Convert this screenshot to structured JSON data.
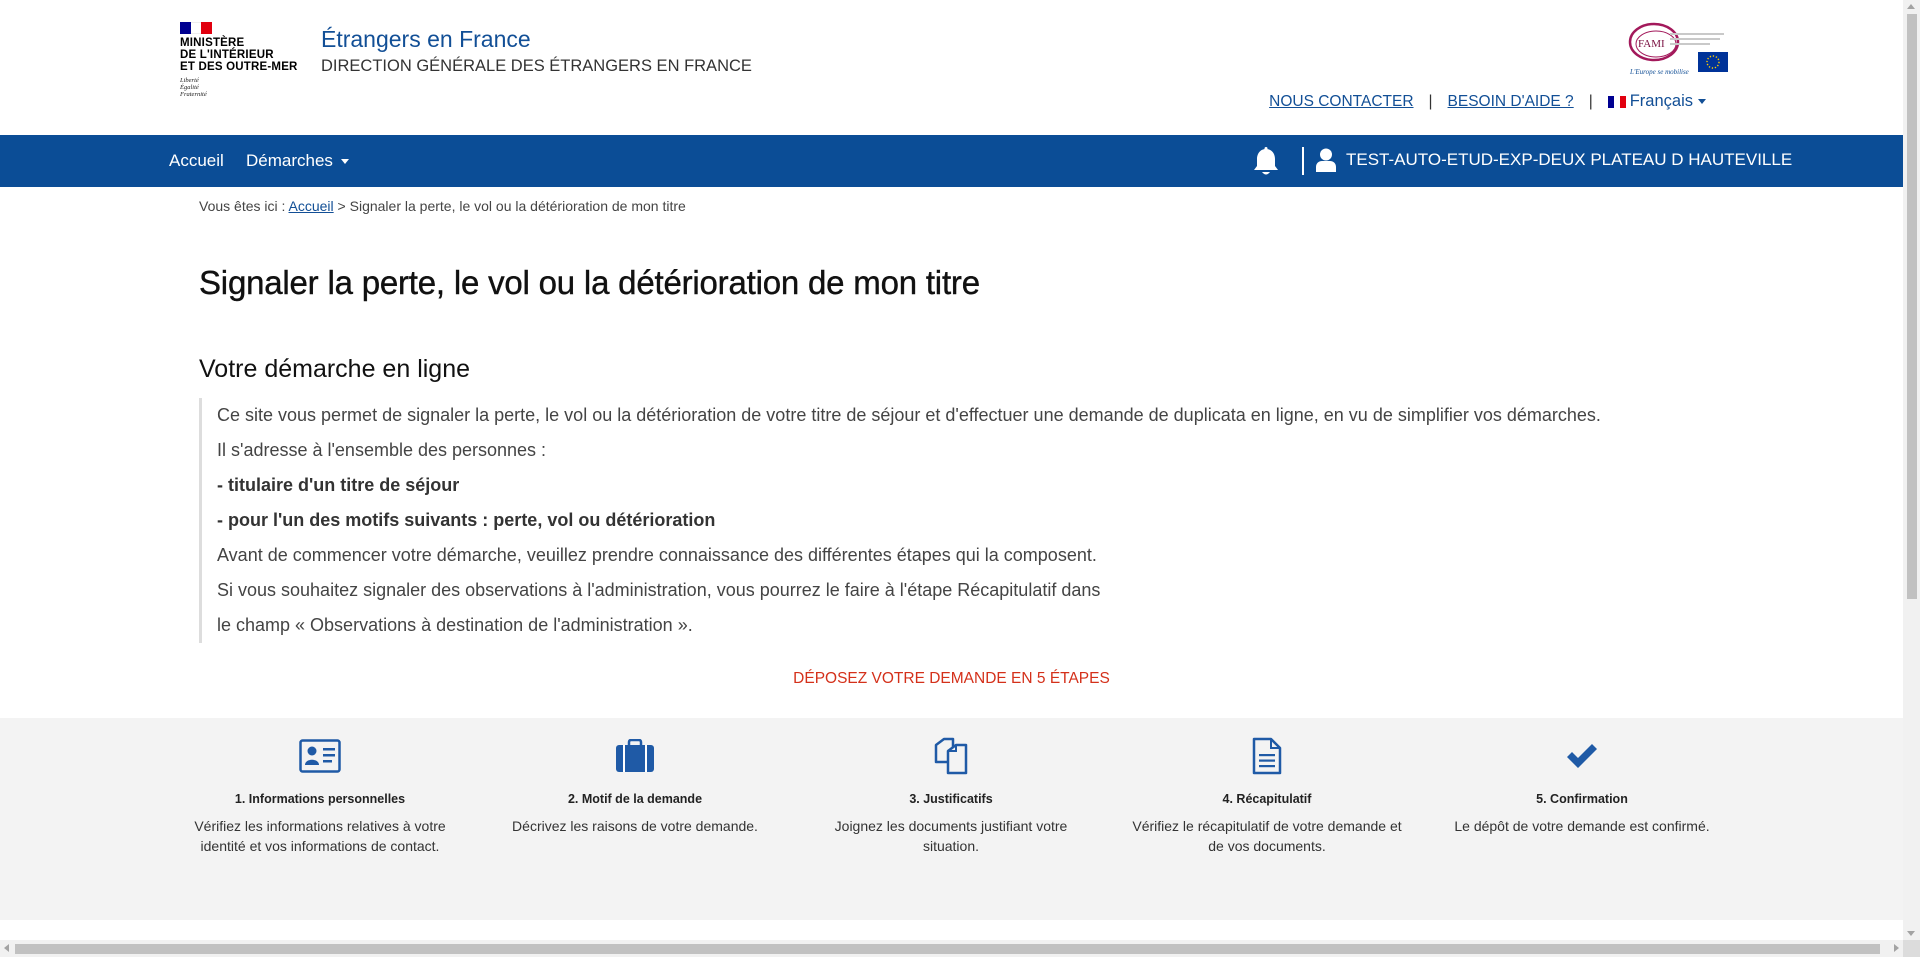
{
  "header": {
    "ministry_name_lines": [
      "MINISTÈRE",
      "DE L'INTÉRIEUR",
      "ET DES OUTRE-MER"
    ],
    "ministry_motto_lines": [
      "Liberté",
      "Égalité",
      "Fraternité"
    ],
    "site_title": "Étrangers en France",
    "site_subtitle": "DIRECTION GÉNÉRALE DES ÉTRANGERS EN FRANCE",
    "fami_logo_text": "FAMI",
    "fami_logo_tagline": "L'Europe se mobilise",
    "contact_link": "NOUS CONTACTER",
    "help_link": "BESOIN D'AIDE ?",
    "separator": "|",
    "language": "Français"
  },
  "navbar": {
    "home": "Accueil",
    "procedures": "Démarches",
    "user_name": "TEST-AUTO-ETUD-EXP-DEUX PLATEAU D HAUTEVILLE",
    "bell_icon": "bell-icon",
    "user_icon": "user-icon"
  },
  "breadcrumb": {
    "prefix": "Vous êtes ici :",
    "home_link": "Accueil",
    "separator": ">",
    "current": "Signaler la perte, le vol ou la détérioration de mon titre"
  },
  "main": {
    "page_title": "Signaler la perte, le vol ou la détérioration de mon titre",
    "section_title": "Votre démarche en ligne",
    "intro_lines": [
      {
        "text": "Ce site vous permet de signaler la perte, le vol ou la détérioration de votre titre de séjour et d'effectuer une demande de duplicata en ligne, en vu de simplifier vos démarches.",
        "bold": false
      },
      {
        "text": "Il s'adresse à l'ensemble des personnes :",
        "bold": false
      },
      {
        "text": "- titulaire d'un titre de séjour",
        "bold": true
      },
      {
        "text": "- pour l'un des motifs suivants : perte, vol ou détérioration",
        "bold": true
      },
      {
        "text": "Avant de commencer votre démarche, veuillez prendre connaissance des différentes étapes qui la composent.",
        "bold": false
      },
      {
        "text": "Si vous souhaitez signaler des observations à l'administration, vous pourrez le faire à l'étape Récapitulatif dans",
        "bold": false
      },
      {
        "text": "le champ « Observations à destination de l'administration ».",
        "bold": false
      }
    ],
    "steps_call": "DÉPOSEZ VOTRE DEMANDE EN 5 ÉTAPES"
  },
  "steps": [
    {
      "title": "1. Informations personnelles",
      "desc_lines": [
        "Vérifiez les informations relatives à votre",
        "identité et vos informations de contact."
      ],
      "icon": "id-card-icon"
    },
    {
      "title": "2. Motif de la demande",
      "desc_lines": [
        "Décrivez les raisons de votre demande."
      ],
      "icon": "briefcase-icon"
    },
    {
      "title": "3. Justificatifs",
      "desc_lines": [
        "Joignez les documents justifiant votre",
        "situation."
      ],
      "icon": "documents-icon"
    },
    {
      "title": "4. Récapitulatif",
      "desc_lines": [
        "Vérifiez le récapitulatif de votre demande et",
        "de vos documents."
      ],
      "icon": "file-text-icon"
    },
    {
      "title": "5. Confirmation",
      "desc_lines": [
        "Le dépôt de votre demande est confirmé."
      ],
      "icon": "checkmark-icon"
    }
  ],
  "colors": {
    "primary_blue": "#0b4d96",
    "link_blue": "#124f96",
    "accent_red": "#d4301a",
    "steps_bg": "#f3f3f3",
    "flag_blue": "#000091",
    "flag_red": "#e1000f"
  }
}
